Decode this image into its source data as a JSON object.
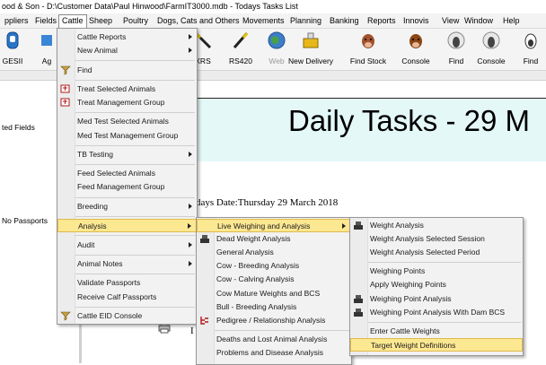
{
  "window": {
    "title": "ood & Son - D:\\Customer Data\\Paul Hinwood\\FarmIT3000.mdb - Todays Tasks List"
  },
  "menubar": [
    "ppliers",
    "Fields",
    "Cattle",
    "Sheep",
    "Poultry",
    "Dogs, Cats and Others",
    "Movements",
    "Planning",
    "Banking",
    "Reports",
    "Innovis",
    "View",
    "Window",
    "Help"
  ],
  "toolbar": [
    {
      "label": "GESII",
      "icon": "gesii-icon"
    },
    {
      "label": "Ag",
      "icon": "ag-icon"
    },
    {
      "label": "XRS",
      "icon": "xrs-wand-icon"
    },
    {
      "label": "RS420",
      "icon": "rs420-wand-icon"
    },
    {
      "label": "Web",
      "icon": "web-globe-icon"
    },
    {
      "label": "New Delivery",
      "icon": "delivery-icon"
    },
    {
      "label": "Find Stock",
      "icon": "cow-find-stock-icon"
    },
    {
      "label": "Console",
      "icon": "cow-console-icon"
    },
    {
      "label": "Find",
      "icon": "sheep-find-icon"
    },
    {
      "label": "Console",
      "icon": "sheep-console-icon"
    },
    {
      "label": "Find",
      "icon": "goat-find-icon"
    }
  ],
  "left_panel": [
    "ted Fields",
    "No Passports"
  ],
  "banner": {
    "text": "Daily Tasks - 29 M"
  },
  "today_date": "days Date:Thursday 29 March 2018",
  "letter_i": "I",
  "cattle_menu": [
    {
      "label": "Cattle Reports",
      "submenu": true
    },
    {
      "label": "New Animal",
      "submenu": true
    },
    {
      "sep": true
    },
    {
      "label": "Find",
      "icon": "find-icon"
    },
    {
      "sep": true
    },
    {
      "label": "Treat Selected Animals",
      "icon": "treat-icon"
    },
    {
      "label": "Treat Management Group",
      "icon": "treat-icon"
    },
    {
      "sep": true
    },
    {
      "label": "Med Test Selected Animals"
    },
    {
      "label": "Med Test Management Group"
    },
    {
      "sep": true
    },
    {
      "label": "TB Testing",
      "submenu": true
    },
    {
      "sep": true
    },
    {
      "label": "Feed Selected Animals"
    },
    {
      "label": "Feed Management Group"
    },
    {
      "sep": true
    },
    {
      "label": "Breeding",
      "submenu": true
    },
    {
      "sep": true
    },
    {
      "label": "Analysis",
      "submenu": true,
      "highlight": true
    },
    {
      "sep": true
    },
    {
      "label": "Audit",
      "submenu": true
    },
    {
      "sep": true
    },
    {
      "label": "Animal Notes",
      "submenu": true
    },
    {
      "sep": true
    },
    {
      "label": "Validate Passports"
    },
    {
      "label": "Receive Calf Passports"
    },
    {
      "sep": true
    },
    {
      "label": "Cattle EID Console",
      "icon": "eid-icon"
    }
  ],
  "analysis_menu": [
    {
      "label": "Live Weighing and Analysis",
      "submenu": true,
      "highlight": true
    },
    {
      "label": "Dead Weight Analysis",
      "icon": "scale-icon"
    },
    {
      "label": "General Analysis"
    },
    {
      "label": "Cow - Breeding Analysis"
    },
    {
      "label": "Cow - Calving Analysis"
    },
    {
      "label": "Cow Mature Weights and BCS"
    },
    {
      "label": "Bull - Breeding Analysis"
    },
    {
      "label": "Pedigree / Relationship Analysis",
      "icon": "pedigree-icon"
    },
    {
      "sep": true
    },
    {
      "label": "Deaths and Lost Animal Analysis"
    },
    {
      "label": "Problems and Disease Analysis"
    }
  ],
  "weighing_menu": [
    {
      "label": "Weight Analysis",
      "icon": "scale-icon"
    },
    {
      "label": "Weight Analysis Selected Session"
    },
    {
      "label": "Weight Analysis Selected Period"
    },
    {
      "sep": true
    },
    {
      "label": "Weighing Points"
    },
    {
      "label": "Apply Weighing Points"
    },
    {
      "label": "Weighing Point Analysis",
      "icon": "scale-icon"
    },
    {
      "label": "Weighing Point Analysis With Dam BCS",
      "icon": "scale-icon"
    },
    {
      "sep": true
    },
    {
      "label": "Enter Cattle Weights"
    },
    {
      "label": "Target Weight Definitions",
      "highlight": true
    }
  ],
  "colors": {
    "highlight": "#fde892",
    "banner_bg": "#e4f8f8",
    "menu_bg": "#f2f2f2"
  }
}
